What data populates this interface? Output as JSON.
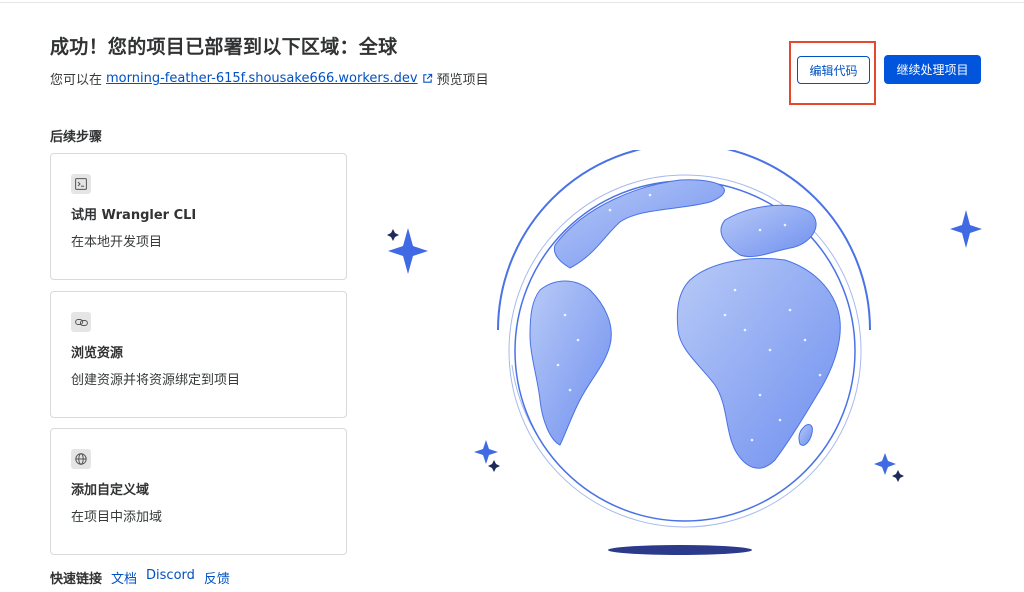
{
  "header": {
    "title": "成功！您的项目已部署到以下区域：全球",
    "preview_prefix": "您可以在",
    "preview_link": "morning-feather-615f.shousake666.workers.dev",
    "preview_suffix": "预览项目"
  },
  "actions": {
    "edit_code": "编辑代码",
    "continue": "继续处理项目"
  },
  "steps": {
    "heading": "后续步骤",
    "items": [
      {
        "icon": "terminal-icon",
        "title": "试用 Wrangler CLI",
        "desc": "在本地开发项目"
      },
      {
        "icon": "link-icon",
        "title": "浏览资源",
        "desc": "创建资源并将资源绑定到项目"
      },
      {
        "icon": "globe-icon",
        "title": "添加自定义域",
        "desc": "在项目中添加域"
      }
    ]
  },
  "quick_links": {
    "label": "快速链接",
    "links": [
      "文档",
      "Discord",
      "反馈"
    ]
  },
  "colors": {
    "primary": "#0055dc",
    "link": "#0051c3",
    "highlight": "#e5472f",
    "globe_land": "#7f9ef0",
    "globe_outline": "#4a72e6"
  }
}
